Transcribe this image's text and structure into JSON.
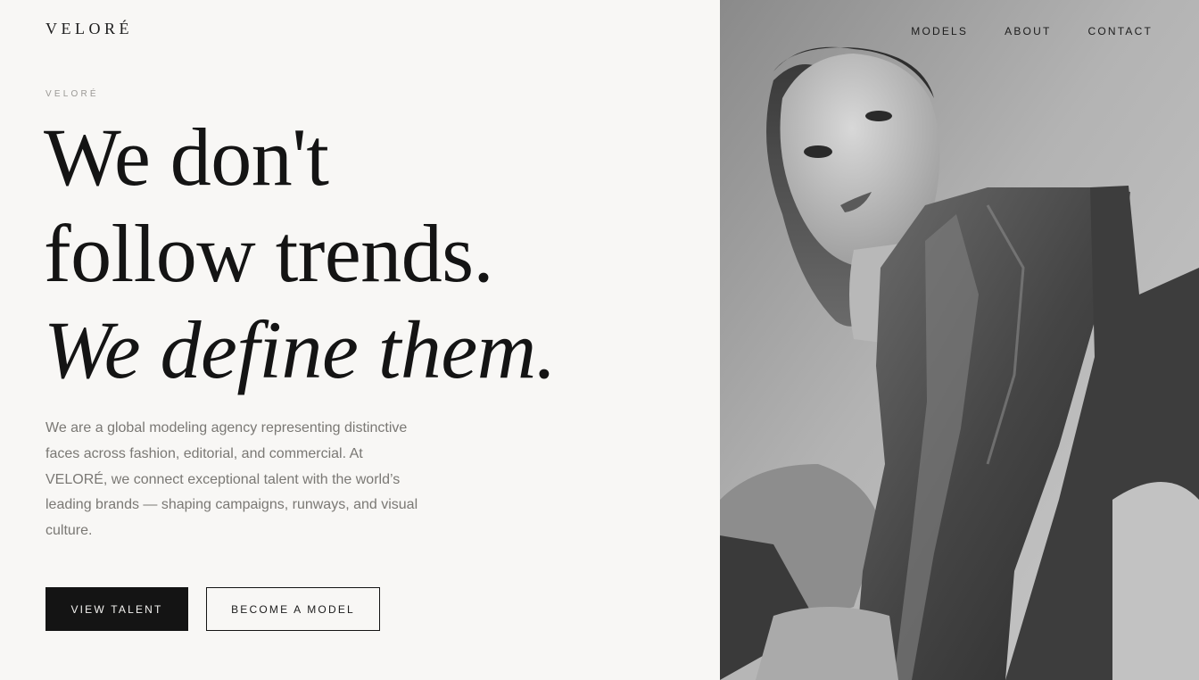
{
  "brand": {
    "logo": "VELORÉ"
  },
  "nav": {
    "items": [
      {
        "label": "MODELS"
      },
      {
        "label": "ABOUT"
      },
      {
        "label": "CONTACT"
      }
    ]
  },
  "hero": {
    "eyebrow": "VELORÉ",
    "headline_line1": "We don't",
    "headline_line2": "follow trends.",
    "headline_line3": "We define them.",
    "intro": "We are a global modeling agency representing distinctive faces across fashion, editorial, and commercial. At VELORÉ, we connect exceptional talent with the world’s leading brands — shaping campaigns, runways, and visual culture.",
    "primary_button": "VIEW TALENT",
    "secondary_button": "BECOME A MODEL"
  },
  "colors": {
    "background": "#f8f7f5",
    "text": "#141414",
    "muted": "#7a7874",
    "button_dark": "#141414"
  },
  "icons": {
    "hero_image": "portrait-photo"
  }
}
